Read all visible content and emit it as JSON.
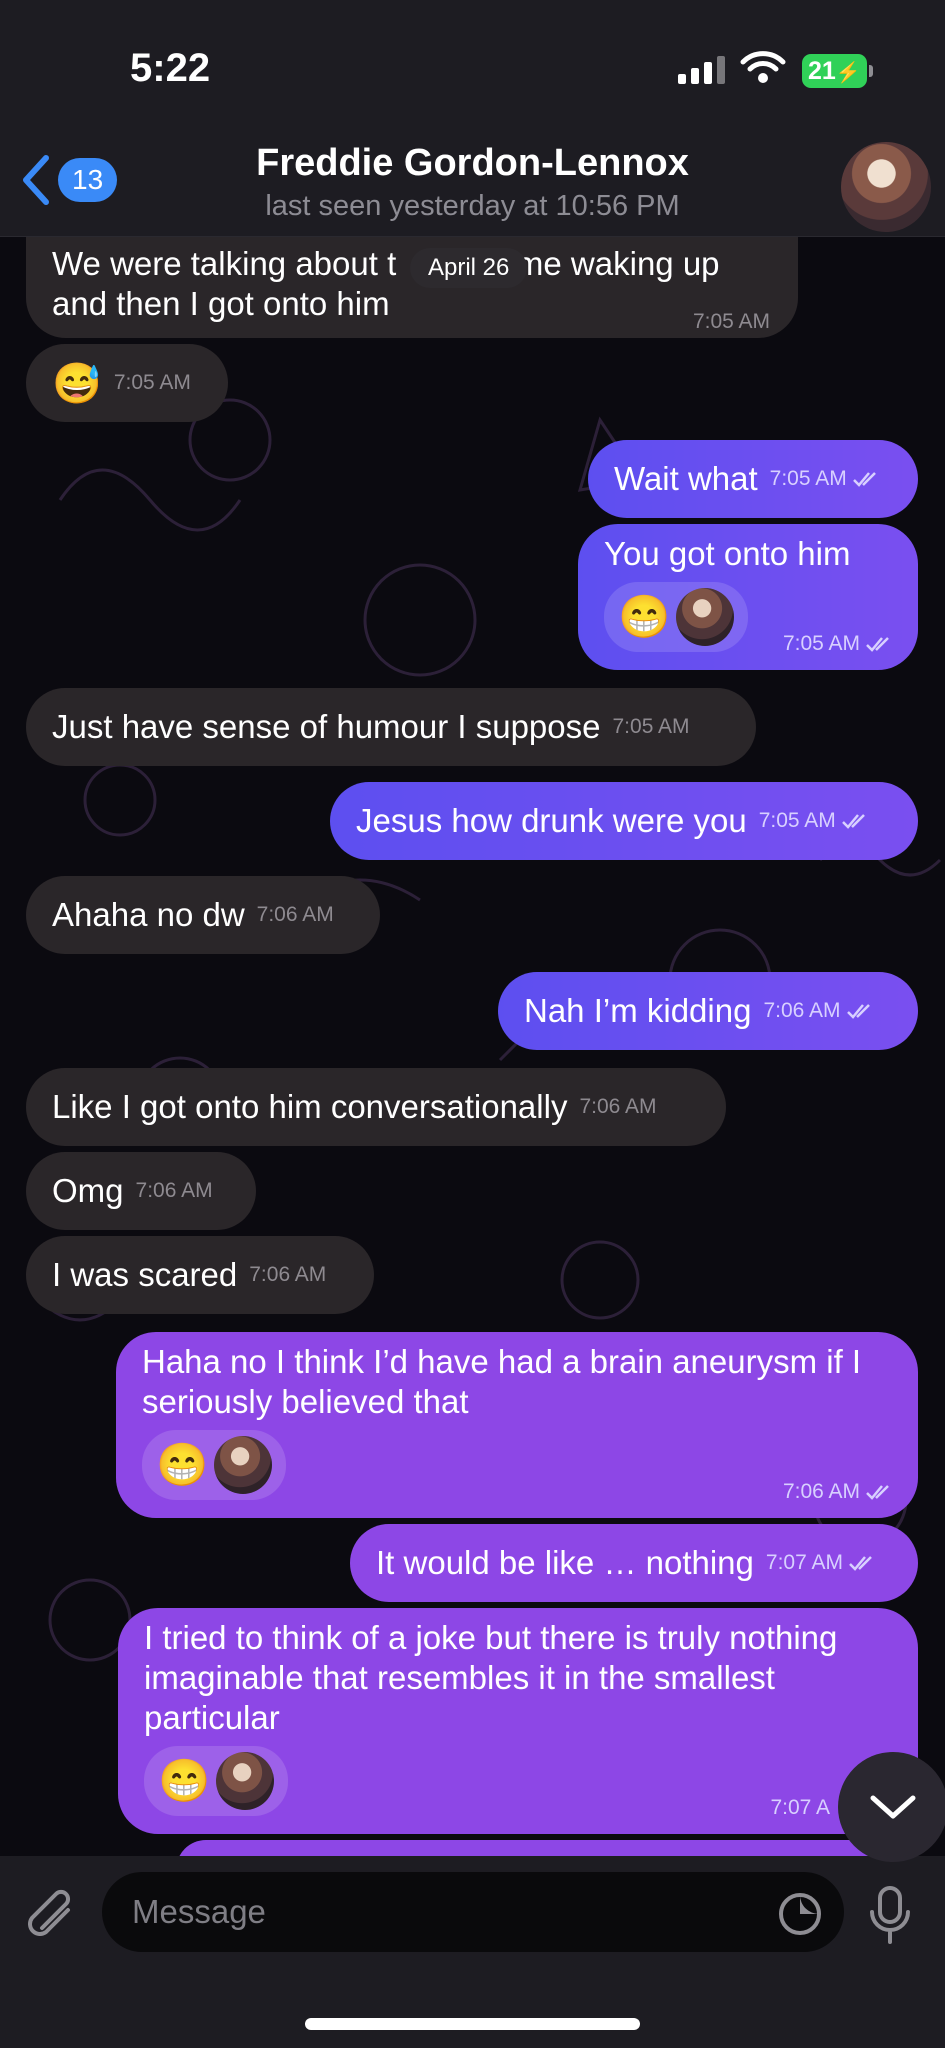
{
  "status_bar": {
    "time": "5:22",
    "battery": "21"
  },
  "header": {
    "back_count": "13",
    "title": "Freddie Gordon-Lennox",
    "subtitle": "last seen yesterday at 10:56 PM"
  },
  "date_pill": "April 26",
  "messages": [
    {
      "dir": "in",
      "text": "We were talking about the way me waking up and then I got onto him",
      "line1": "We were talking about t",
      "line1b": "y me waking up",
      "line2": "and then I got onto him",
      "time": "7:05 AM"
    },
    {
      "dir": "in",
      "text": "😅",
      "time": "7:05 AM"
    },
    {
      "dir": "out",
      "text": "Wait what",
      "time": "7:05 AM"
    },
    {
      "dir": "out",
      "text": "You got onto him",
      "reaction": "😁",
      "time": "7:05 AM"
    },
    {
      "dir": "in",
      "text": "Just have sense of humour I suppose",
      "time": "7:05 AM"
    },
    {
      "dir": "out",
      "text": "Jesus how drunk were you",
      "time": "7:05 AM"
    },
    {
      "dir": "in",
      "text": "Ahaha no dw",
      "time": "7:06 AM"
    },
    {
      "dir": "out",
      "text": "Nah I’m kidding",
      "time": "7:06 AM"
    },
    {
      "dir": "in",
      "text": "Like I got onto him conversationally",
      "time": "7:06 AM"
    },
    {
      "dir": "in",
      "text": "Omg",
      "time": "7:06 AM"
    },
    {
      "dir": "in",
      "text": "I was scared",
      "time": "7:06 AM"
    },
    {
      "dir": "out",
      "line1": "Haha no I think I’d have had a brain aneurysm if I",
      "line2": "seriously believed that",
      "reaction": "😁",
      "time": "7:06 AM"
    },
    {
      "dir": "out",
      "text": "It would be like … nothing",
      "time": "7:07 AM"
    },
    {
      "dir": "out",
      "line1": "I tried to think of a joke but there is truly nothing",
      "line2": "imaginable that resembles it in the smallest",
      "line3": "particular",
      "reaction": "😁",
      "time": "7:07 A"
    }
  ],
  "composer": {
    "placeholder": "Message"
  },
  "colors": {
    "incoming": "#2a2629",
    "outgoing_blue": "#5d4ff0",
    "outgoing_purple": "#8d47e6",
    "accent": "#3a8af7"
  },
  "icons": [
    "back-chevron-icon",
    "signal-icon",
    "wifi-icon",
    "battery-icon",
    "read-check-icon",
    "scroll-down-icon",
    "attach-icon",
    "sticker-icon",
    "mic-icon"
  ]
}
